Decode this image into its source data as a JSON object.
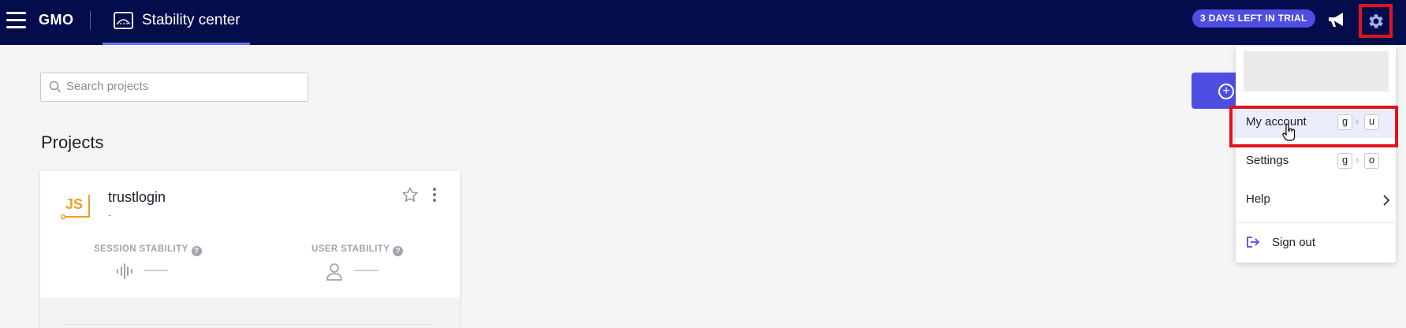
{
  "header": {
    "org_name": "GMO",
    "app_title": "Stability center",
    "trial_badge": "3 DAYS LEFT IN TRIAL",
    "colors": {
      "background": "#040d4b",
      "accent": "#4f4ee3",
      "highlight": "#e0141f"
    },
    "icons": [
      "hamburger-menu-icon",
      "stability-center-icon",
      "megaphone-icon",
      "gear-icon"
    ]
  },
  "main": {
    "search": {
      "placeholder": "Search projects",
      "value": ""
    },
    "create_button_icon": "plus-circle-icon",
    "projects_heading": "Projects",
    "project": {
      "logo_text": "JS",
      "name": "trustlogin",
      "subtitle": "-",
      "session_stability": {
        "label": "SESSION STABILITY",
        "help": "?",
        "value": "——"
      },
      "user_stability": {
        "label": "USER STABILITY",
        "help": "?",
        "value": "——"
      }
    }
  },
  "menu": {
    "account": {
      "label": "My account",
      "key1": "g",
      "key2": "u"
    },
    "settings": {
      "label": "Settings",
      "key1": "g",
      "key2": "o"
    },
    "help": {
      "label": "Help"
    },
    "signout": {
      "label": "Sign out"
    },
    "key_separator": "›"
  }
}
